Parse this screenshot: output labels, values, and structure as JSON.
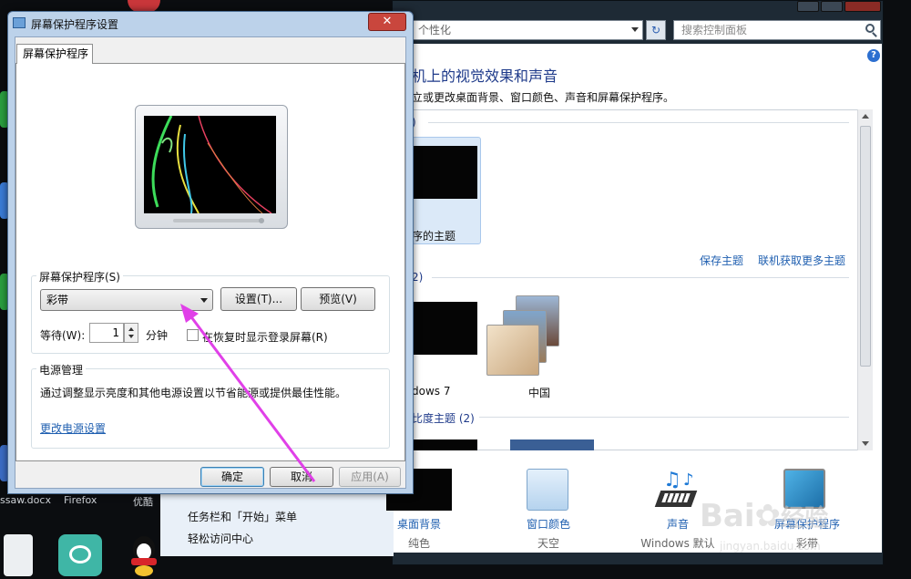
{
  "desktop": {
    "labels": [
      "ssaw.docx",
      "Firefox",
      "优酷"
    ]
  },
  "control_panel": {
    "address": "个性化",
    "search_placeholder": "搜索控制面板",
    "heading": "机上的视觉效果和声音",
    "subheading": "立或更改桌面背景、窗口颜色、声音和屏幕保护程序。",
    "group1_count": ")",
    "selected_theme_label": "序的主题",
    "save_theme": "保存主题",
    "get_more_themes": "联机获取更多主题",
    "group2_count": "2)",
    "theme_win7": "dows 7",
    "theme_china": "中国",
    "group3_label": "比度主题 (2)",
    "nav": [
      "任务栏和「开始」菜单",
      "轻松访问中心"
    ],
    "tiles": [
      {
        "label": "桌面背景",
        "sub": "纯色"
      },
      {
        "label": "窗口颜色",
        "sub": "天空"
      },
      {
        "label": "声音",
        "sub": "Windows 默认"
      },
      {
        "label": "屏幕保护程序",
        "sub": "彩带"
      }
    ]
  },
  "dialog": {
    "title": "屏幕保护程序设置",
    "tab": "屏幕保护程序",
    "screensaver_group": "屏幕保护程序(S)",
    "screensaver_value": "彩带",
    "settings_btn": "设置(T)...",
    "preview_btn": "预览(V)",
    "wait_label": "等待(W):",
    "wait_value": "1",
    "minutes": "分钟",
    "resume_checkbox": "在恢复时显示登录屏幕(R)",
    "power_group": "电源管理",
    "power_desc": "通过调整显示亮度和其他电源设置以节省能源或提供最佳性能。",
    "power_link": "更改电源设置",
    "ok": "确定",
    "cancel": "取消",
    "apply": "应用(A)"
  },
  "watermark": {
    "brand": "Bai",
    "brand2": "经验",
    "url": "jingyan.baidu.com"
  },
  "colors": {
    "link": "#1f5fb0",
    "annotation_arrow": "#e040e8"
  }
}
